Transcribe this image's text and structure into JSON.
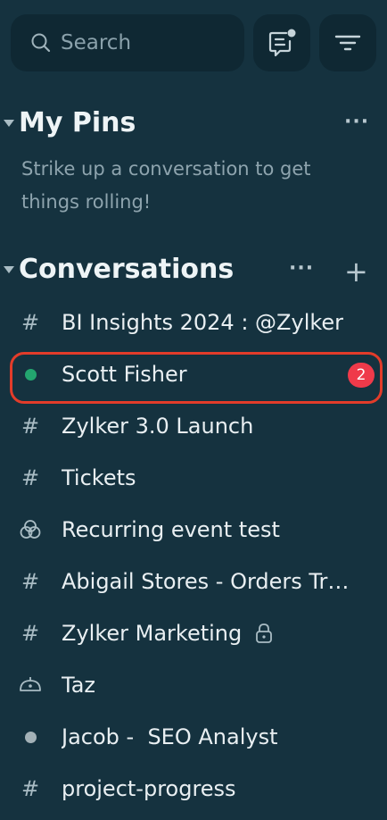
{
  "search": {
    "placeholder": "Search"
  },
  "toolbar": {
    "compose_icon": "chat-compose-icon",
    "filter_icon": "filter-icon"
  },
  "pins": {
    "title": "My Pins",
    "more": "···",
    "empty_message": "Strike up a conversation to get things rolling!"
  },
  "conversations": {
    "title": "Conversations",
    "more": "···",
    "add": "+",
    "items": [
      {
        "icon": "channel-hash-icon",
        "label": "BI Insights 2024 : @Zylker"
      },
      {
        "icon": "online-status-icon",
        "label": "Scott Fisher",
        "unread": "2",
        "selected": true
      },
      {
        "icon": "channel-hash-icon",
        "label": "Zylker 3.0 Launch"
      },
      {
        "icon": "channel-hash-icon",
        "label": "Tickets"
      },
      {
        "icon": "group-circles-icon",
        "label": "Recurring event test"
      },
      {
        "icon": "channel-hash-icon",
        "label": "Abigail Stores - Orders Tracking"
      },
      {
        "icon": "channel-hash-icon",
        "label": "Zylker Marketing",
        "locked": true
      },
      {
        "icon": "bot-icon",
        "label": "Taz"
      },
      {
        "icon": "offline-status-icon",
        "label": "Jacob -  SEO Analyst"
      },
      {
        "icon": "channel-hash-icon",
        "label": "project-progress"
      }
    ]
  },
  "colors": {
    "background": "#15323f",
    "highlight": "#e23c2a",
    "badge": "#ef3a4a",
    "online": "#23a66f"
  }
}
